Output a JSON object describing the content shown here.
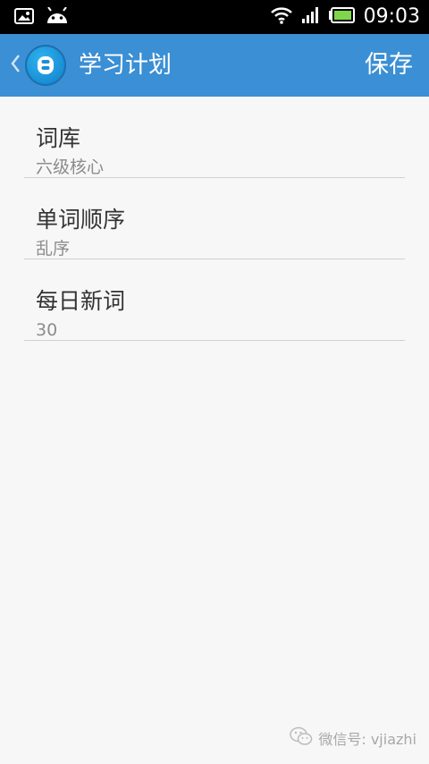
{
  "status_bar": {
    "time": "09:03",
    "icons": [
      "image-notification-icon",
      "android-icon",
      "wifi-icon",
      "signal-icon",
      "battery-icon"
    ]
  },
  "header": {
    "title": "学习计划",
    "save_label": "保存",
    "back_icon": "chevron-left-icon",
    "logo_icon": "app-logo-icon",
    "background_color": "#3b8fd4"
  },
  "settings": {
    "items": [
      {
        "title": "词库",
        "value": "六级核心"
      },
      {
        "title": "单词顺序",
        "value": "乱序"
      },
      {
        "title": "每日新词",
        "value": "30"
      }
    ]
  },
  "watermark": {
    "text": "微信号: vjiazhi"
  }
}
